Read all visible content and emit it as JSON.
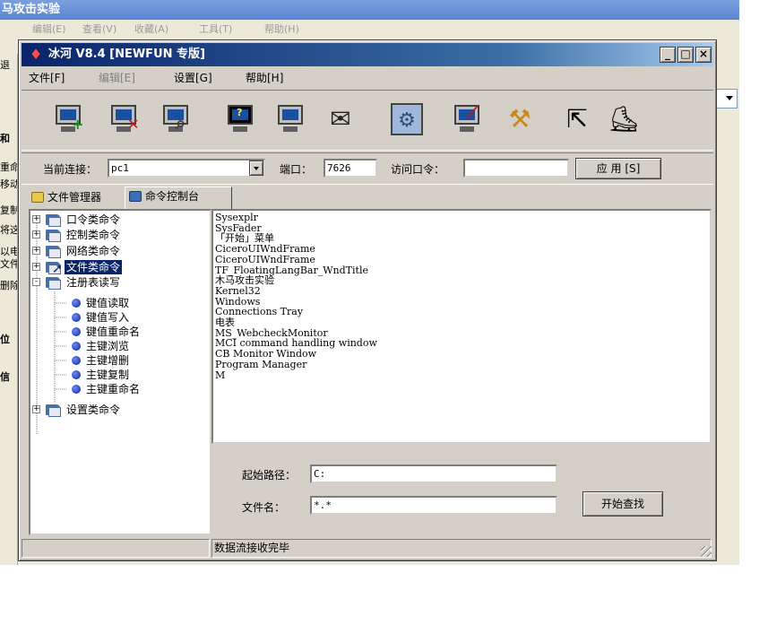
{
  "background_window": {
    "title": "马攻击实验",
    "menu": [
      "编辑(E)",
      "查看(V)",
      "收藏(A)",
      "工具(T)",
      "帮助(H)"
    ],
    "fragments": [
      {
        "text": "退",
        "bold": false
      },
      {
        "text": "和",
        "bold": true
      },
      {
        "text": "重命",
        "bold": false
      },
      {
        "text": "移动",
        "bold": false
      },
      {
        "text": "复制",
        "bold": false
      },
      {
        "text": "将这",
        "bold": false
      },
      {
        "text": "以电",
        "bold": false
      },
      {
        "text": "文件",
        "bold": false
      },
      {
        "text": "删除",
        "bold": false
      },
      {
        "text": "位",
        "bold": true
      },
      {
        "text": "信",
        "bold": true
      }
    ]
  },
  "window": {
    "title": "冰河 V8.4 [NEWFUN 专版]",
    "controls": {
      "minimize": "_",
      "maximize": "□",
      "close": "×"
    }
  },
  "menu": {
    "file": "文件[F]",
    "edit": "编辑[E]",
    "settings": "设置[G]",
    "help": "帮助[H]"
  },
  "toolbar": {
    "icons": [
      "add-host-icon",
      "remove-host-icon",
      "search-host-icon",
      "screen-capture-icon",
      "screen-control-icon",
      "mailbox-icon",
      "settings-gear-icon",
      "remote-tools-icon",
      "config-server-icon",
      "return-arrow-icon",
      "exit-boot-icon"
    ]
  },
  "connection": {
    "current_label": "当前连接：",
    "current_value": "pc1",
    "port_label": "端口：",
    "port_value": "7626",
    "password_label": "访问口令：",
    "password_value": "",
    "apply_label": "应 用 [S]"
  },
  "tabs": [
    {
      "label": "文件管理器",
      "active": false,
      "icon": "folder-icon"
    },
    {
      "label": "命令控制台",
      "active": true,
      "icon": "console-icon"
    }
  ],
  "tree": [
    {
      "label": "口令类命令",
      "level": 0,
      "expander": "+",
      "icon": "folder"
    },
    {
      "label": "控制类命令",
      "level": 0,
      "expander": "+",
      "icon": "folder"
    },
    {
      "label": "网络类命令",
      "level": 0,
      "expander": "+",
      "icon": "folder"
    },
    {
      "label": "文件类命令",
      "level": 0,
      "expander": "+",
      "icon": "folder",
      "selected": true
    },
    {
      "label": "注册表读写",
      "level": 0,
      "expander": "-",
      "icon": "folder"
    },
    {
      "label": "键值读取",
      "level": 1,
      "icon": "dot"
    },
    {
      "label": "键值写入",
      "level": 1,
      "icon": "dot"
    },
    {
      "label": "键值重命名",
      "level": 1,
      "icon": "dot"
    },
    {
      "label": "主键浏览",
      "level": 1,
      "icon": "dot"
    },
    {
      "label": "主键增删",
      "level": 1,
      "icon": "dot"
    },
    {
      "label": "主键复制",
      "level": 1,
      "icon": "dot"
    },
    {
      "label": "主键重命名",
      "level": 1,
      "icon": "dot"
    },
    {
      "label": "设置类命令",
      "level": 0,
      "expander": "+",
      "icon": "folder"
    }
  ],
  "list": [
    "Sysexplr",
    "SysFader",
    "「开始」菜单",
    "CiceroUIWndFrame",
    "CiceroUIWndFrame",
    "TF_FloatingLangBar_WndTitle",
    "木马攻击实验",
    "Kernel32",
    "Windows",
    "Connections Tray",
    "电表",
    "MS_WebcheckMonitor",
    "MCI command handling window",
    "CB Monitor Window",
    "Program Manager",
    "M"
  ],
  "search": {
    "path_label": "起始路径：",
    "path_value": "C:",
    "filename_label": "文件名：",
    "filename_value": "*.*",
    "start_label": "开始查找"
  },
  "status": {
    "left": "",
    "message": "数据流接收完毕"
  }
}
